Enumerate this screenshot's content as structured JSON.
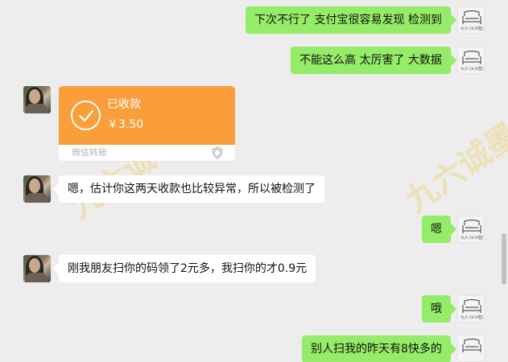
{
  "messages": [
    {
      "from": "self",
      "text": "下次不行了 支付宝很容易发现 检测到"
    },
    {
      "from": "self",
      "text": "不能这么高 太厉害了 大数据"
    },
    {
      "from": "other",
      "type": "transfer",
      "status": "已收款",
      "amount": "￥3.50",
      "label": "微信转账"
    },
    {
      "from": "other",
      "text": "嗯，估计你这两天收款也比较异常，所以被检测了"
    },
    {
      "from": "self",
      "text": "嗯"
    },
    {
      "from": "other",
      "text": "刚我朋友扫你的码领了2元多，我扫你的才0.9元"
    },
    {
      "from": "self",
      "text": "哦"
    },
    {
      "from": "self",
      "text": "别人扫我的昨天有8快多的"
    }
  ],
  "watermark": {
    "left": "九六诚",
    "right": "九六诚墨商"
  },
  "avatar_self_signature": "九六 DCR智盈",
  "colors": {
    "self_bubble": "#95ec69",
    "other_bubble": "#ffffff",
    "transfer": "#fa9d3b",
    "background": "#ededed"
  },
  "icons": {
    "transfer_check": "check-circle-icon",
    "transfer_brand": "wechat-pay-shield-icon",
    "scroll": "scrollbar"
  }
}
